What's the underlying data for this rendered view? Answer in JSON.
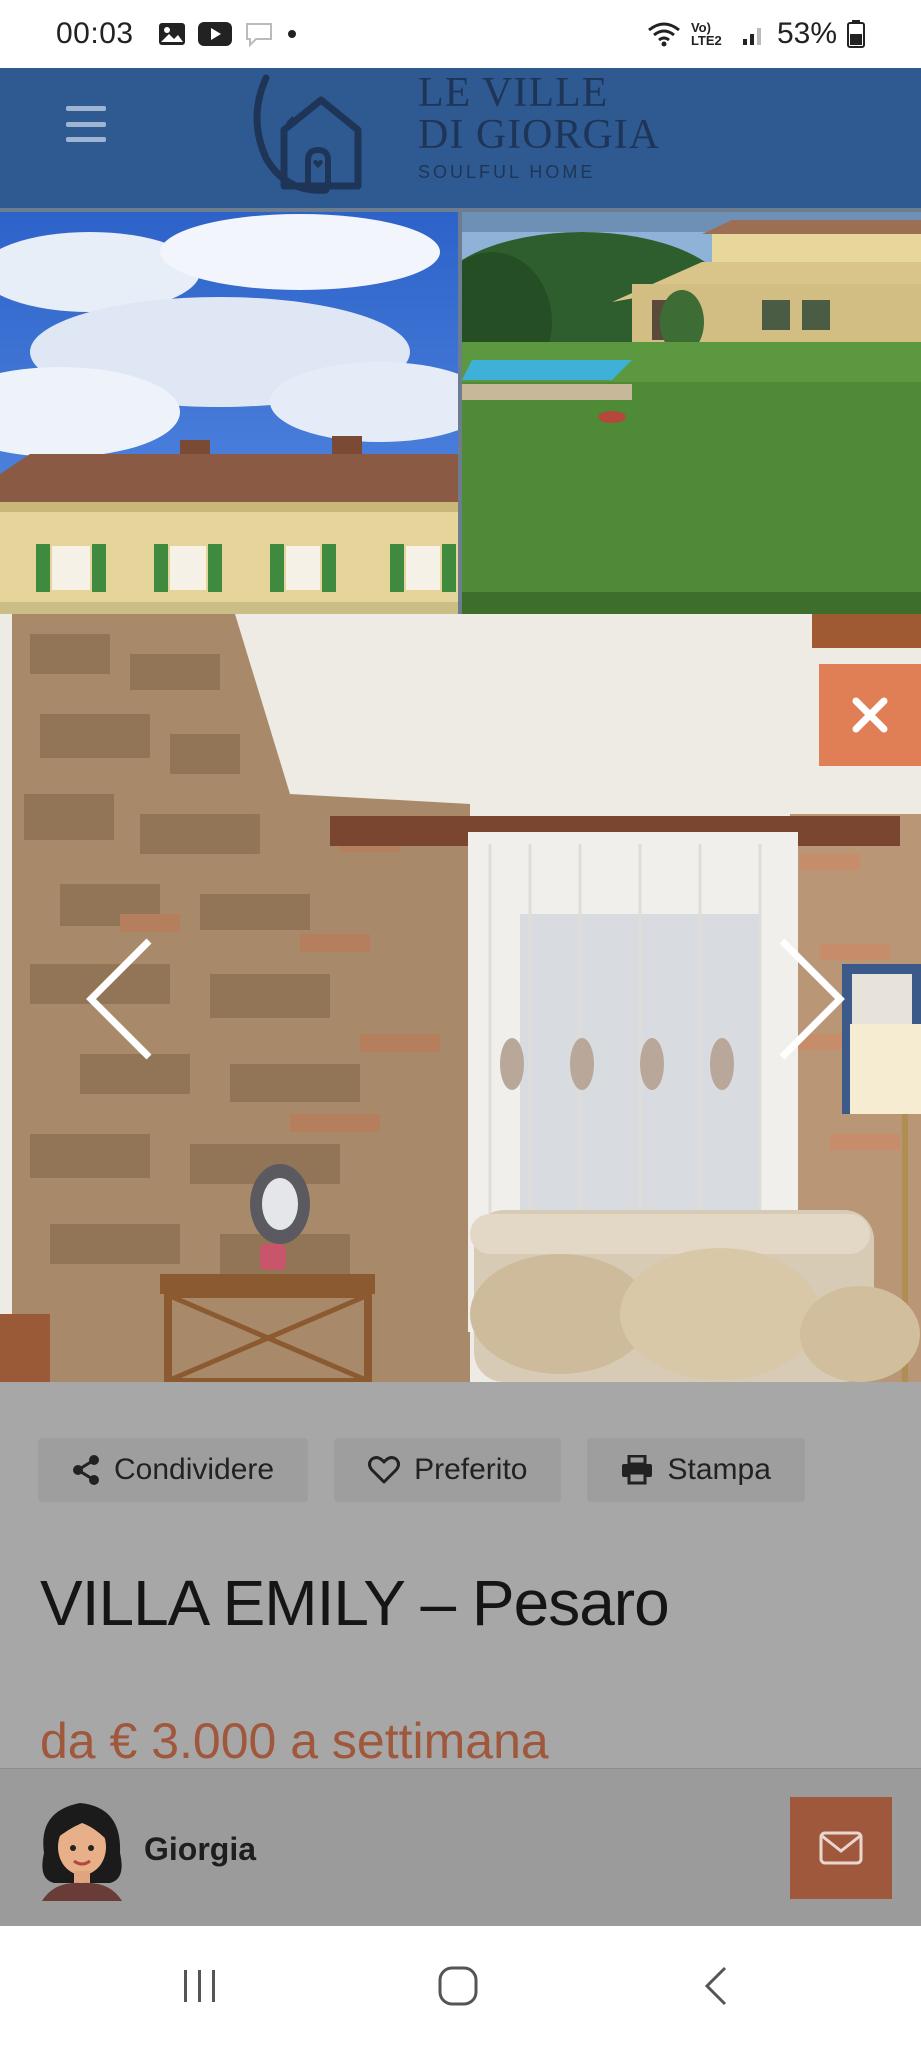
{
  "status_bar": {
    "time": "00:03",
    "network": "Vo) LTE2",
    "battery": "53%"
  },
  "header": {
    "logo_line1": "LE VILLE",
    "logo_line2": "DI GIORGIA",
    "logo_tagline": "SOULFUL HOME",
    "bg_color": "#2e5a91"
  },
  "actions": {
    "share_label": "Condividere",
    "favorite_label": "Preferito",
    "print_label": "Stampa"
  },
  "listing": {
    "title": "VILLA EMILY – Pesaro",
    "price": "da € 3.000 a settimana"
  },
  "agent": {
    "name": "Giorgia"
  },
  "colors": {
    "accent_orange": "#e07f55",
    "accent_brown": "#a0583d"
  }
}
